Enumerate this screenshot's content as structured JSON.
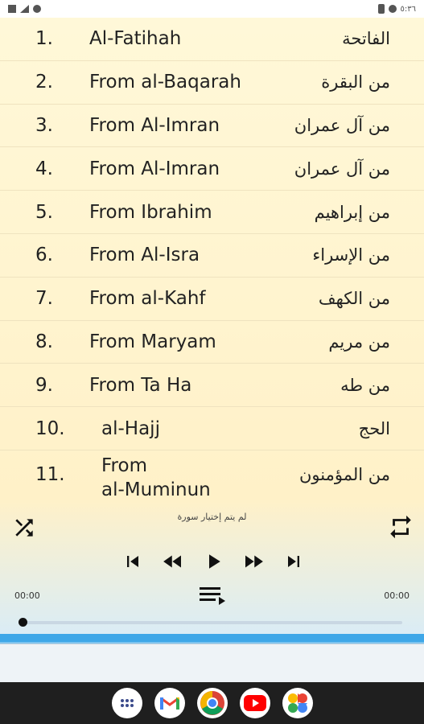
{
  "status_bar": {
    "time": "٥:٣٦"
  },
  "surahs": [
    {
      "number": "1.",
      "english": "Al-Fatihah",
      "arabic": "الفاتحة"
    },
    {
      "number": "2.",
      "english": "From al-Baqarah",
      "arabic": "من البقرة"
    },
    {
      "number": "3.",
      "english": "From Al-Imran",
      "arabic": "من آل عمران"
    },
    {
      "number": "4.",
      "english": "From Al-Imran",
      "arabic": "من آل عمران"
    },
    {
      "number": "5.",
      "english": "From Ibrahim",
      "arabic": "من إبراهيم"
    },
    {
      "number": "6.",
      "english": "From Al-Isra",
      "arabic": "من الإسراء"
    },
    {
      "number": "7.",
      "english": "From al-Kahf",
      "arabic": "من الكهف"
    },
    {
      "number": "8.",
      "english": "From Maryam",
      "arabic": "من مريم"
    },
    {
      "number": "9.",
      "english": "From Ta Ha",
      "arabic": "من طه"
    },
    {
      "number": "10.",
      "english": "al-Hajj",
      "arabic": "الحج"
    },
    {
      "number": "11.",
      "english": "From\nal-Muminun",
      "arabic": "من المؤمنون"
    }
  ],
  "player": {
    "now_playing": "لم يتم إختيار سورة",
    "time_elapsed": "00:00",
    "time_total": "00:00",
    "progress": 0,
    "icons": [
      "shuffle-icon",
      "repeat-icon",
      "skip-previous-icon",
      "rewind-icon",
      "play-icon",
      "fast-forward-icon",
      "skip-next-icon",
      "queue-music-icon"
    ]
  },
  "dock": {
    "apps": [
      "apps-icon",
      "gmail-icon",
      "chrome-icon",
      "youtube-icon",
      "photos-icon"
    ]
  },
  "colors": {
    "list_bg": "#fff8d8",
    "accent_blue": "#3ea7e8",
    "nav_bg": "#1f1f1f"
  }
}
